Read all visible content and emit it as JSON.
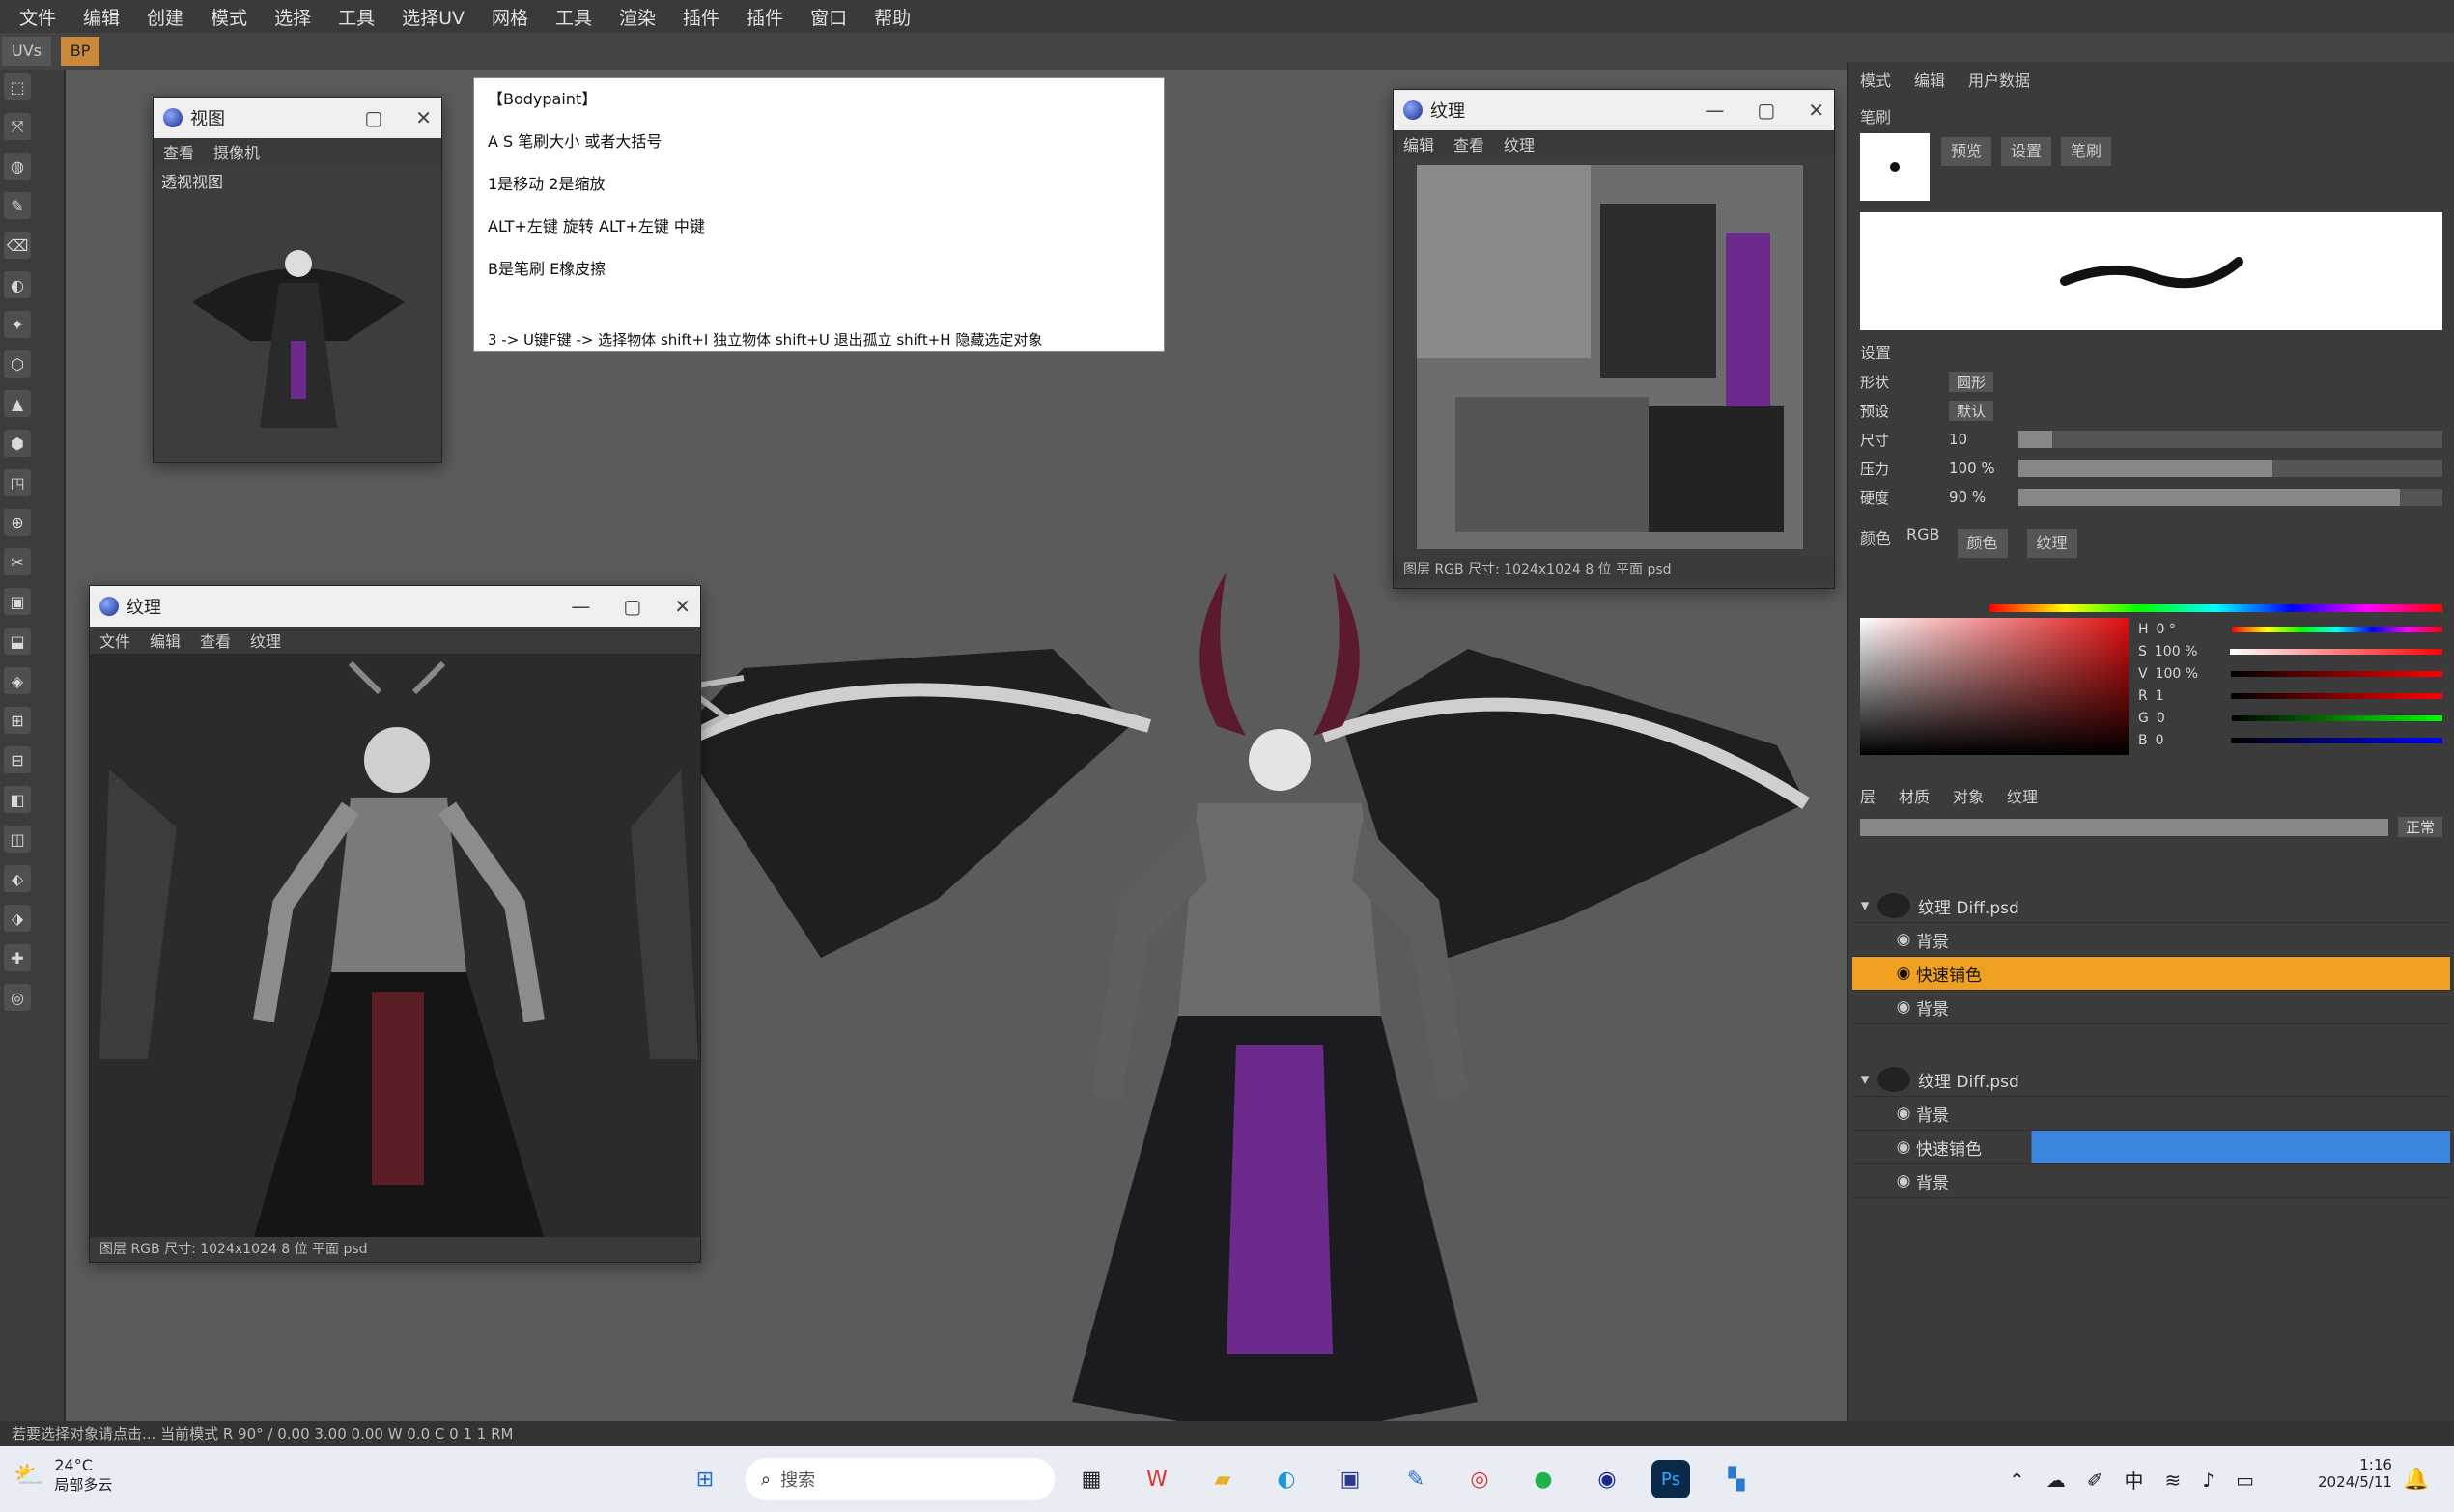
{
  "menubar": {
    "items": [
      "文件",
      "编辑",
      "创建",
      "模式",
      "选择",
      "工具",
      "选择UV",
      "网格",
      "工具",
      "渲染",
      "插件",
      "插件",
      "窗口",
      "帮助"
    ]
  },
  "tabs": [
    "UVs",
    "BP"
  ],
  "note": {
    "title": "【Bodypaint】",
    "lines": [
      "A S 笔刷大小   或者大括号",
      "1是移动   2是缩放",
      "ALT+左键 旋转      ALT+左键 中键",
      "B是笔刷   E橡皮擦",
      "3 -> U键F键   -> 选择物体      shift+I   独立物体      shift+U   退出孤立      shift+H   隐藏选定对象"
    ]
  },
  "window_small": {
    "title": "视图",
    "menu": [
      "查看",
      "摄像机"
    ],
    "label": "透视视图"
  },
  "window_texture_top": {
    "title": "纹理",
    "menu": [
      "编辑",
      "查看",
      "纹理"
    ],
    "status": "图层   RGB   尺寸: 1024x1024   8 位   平面    psd"
  },
  "window_texture_left": {
    "title": "纹理",
    "menu": [
      "文件",
      "编辑",
      "查看",
      "纹理"
    ],
    "status": "图层   RGB   尺寸: 1024x1024   8 位   平面   psd"
  },
  "right_panel": {
    "top_tabs": [
      "模式",
      "编辑",
      "用户数据"
    ],
    "section_brush": "笔刷",
    "brush_tabs": [
      "预览",
      "设置",
      "笔刷"
    ],
    "settings_label": "设置",
    "fields": [
      {
        "label": "形状",
        "value": "圆形"
      },
      {
        "label": "预设",
        "value": "默认"
      },
      {
        "label": "尺寸",
        "value": "10",
        "fill": 0.08
      },
      {
        "label": "压力",
        "value": "100 %",
        "fill": 0.6
      },
      {
        "label": "硬度",
        "value": "90 %",
        "fill": 0.9
      }
    ],
    "color_section": "颜色",
    "color_mode": "RGB",
    "color_tabs": [
      "颜色",
      "纹理"
    ],
    "channel_labels": [
      "H",
      "S",
      "V",
      "R",
      "G",
      "B"
    ],
    "channel_values": [
      "0 °",
      "100 %",
      "100 %",
      "1",
      "0",
      "0"
    ],
    "layers_tabs": [
      "层",
      "材质",
      "对象",
      "纹理"
    ],
    "mode_label": "正常",
    "layers": [
      {
        "name": "纹理 Diff.psd",
        "type": "group"
      },
      {
        "name": "背景",
        "type": "layer"
      },
      {
        "name": "快速铺色",
        "type": "layer",
        "selected": true
      },
      {
        "name": "背景",
        "type": "layer"
      },
      {
        "name": "纹理 Diff.psd",
        "type": "group"
      },
      {
        "name": "背景",
        "type": "layer"
      },
      {
        "name": "快速铺色",
        "type": "layer",
        "selected_blue": true
      },
      {
        "name": "背景",
        "type": "layer"
      }
    ]
  },
  "statusbar": "若要选择对象请点击...   当前模式   R 90°  /  0.00 3.00 0.00  W 0.0   C 0  1 1 RM",
  "taskbar": {
    "weather_temp": "24°C",
    "weather_text": "局部多云",
    "search_placeholder": "搜索",
    "time": "1:16",
    "date": "2024/5/11",
    "ime": "中"
  }
}
